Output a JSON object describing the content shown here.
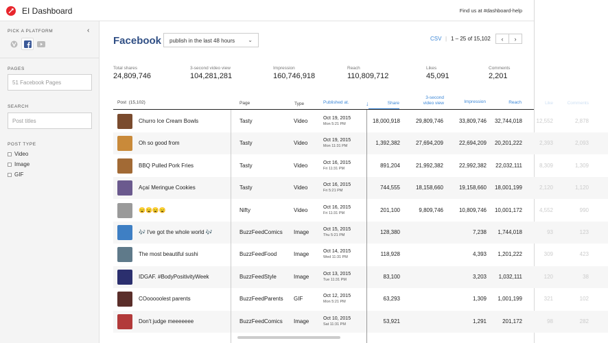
{
  "app": {
    "title": "EI Dashboard",
    "help_text": "Find us at #dashboard-help",
    "brand_color": "#e8262d"
  },
  "sidebar": {
    "platform_heading": "PICK A PLATFORM",
    "platforms": [
      {
        "name": "vine-icon",
        "active": false
      },
      {
        "name": "facebook-icon",
        "active": true
      },
      {
        "name": "youtube-icon",
        "active": false
      }
    ],
    "pages_heading": "PAGES",
    "pages_value": "51 Facebook Pages",
    "search_heading": "SEARCH",
    "search_placeholder": "Post titles",
    "post_type_heading": "POST TYPE",
    "post_types": [
      "Video",
      "Image",
      "GIF"
    ]
  },
  "main": {
    "title": "Facebook",
    "range_select": "publish in the last 48 hours",
    "csv": "CSV",
    "pagination": "1 – 25 of 15,102",
    "accent_color": "#3b86d6"
  },
  "totals": [
    {
      "label": "Total shares",
      "value": "24,809,746"
    },
    {
      "label": "3-second video view",
      "value": "104,281,281"
    },
    {
      "label": "Impression",
      "value": "160,746,918"
    },
    {
      "label": "Reach",
      "value": "110,809,712"
    },
    {
      "label": "Likes",
      "value": "45,091"
    },
    {
      "label": "Comments",
      "value": "2,201"
    }
  ],
  "columns": {
    "post": "Post",
    "post_count": "(15,102)",
    "page": "Page",
    "type": "Type",
    "published": "Published at.",
    "share": "Share",
    "video_view_1": "3-second",
    "video_view_2": "video view",
    "impression": "Impression",
    "reach": "Reach",
    "like": "Like",
    "comments": "Comments"
  },
  "rows": [
    {
      "post": "Churro Ice Cream Bowls",
      "page": "Tasty",
      "type": "Video",
      "date": "Oct 19, 2015",
      "time": "Mon  5:21 PM",
      "share": "18,000,918",
      "view": "29,809,746",
      "impression": "33,809,746",
      "reach": "32,744,018",
      "like": "12,552",
      "comments": "2,878",
      "thumb": "#7a4b2e"
    },
    {
      "post": "Oh so good from",
      "page": "Tasty",
      "type": "Video",
      "date": "Oct 19, 2015",
      "time": "Mon  11:31 PM",
      "share": "1,392,382",
      "view": "27,694,209",
      "impression": "22,694,209",
      "reach": "20,201,222",
      "like": "2,393",
      "comments": "2,093",
      "thumb": "#c98a3a"
    },
    {
      "post": "BBQ Pulled Pork Fries",
      "page": "Tasty",
      "type": "Video",
      "date": "Oct 16, 2015",
      "time": "Fri  11:31 PM",
      "share": "891,204",
      "view": "21,992,382",
      "impression": "22,992,382",
      "reach": "22,032,111",
      "like": "8,309",
      "comments": "1,309",
      "thumb": "#a26a35"
    },
    {
      "post": "Açaí Meringue Cookies",
      "page": "Tasty",
      "type": "Video",
      "date": "Oct 16, 2015",
      "time": "Fri  5:21 PM",
      "share": "744,555",
      "view": "18,158,660",
      "impression": "19,158,660",
      "reach": "18,001,199",
      "like": "2,120",
      "comments": "1,120",
      "thumb": "#6b5a8e"
    },
    {
      "post": "😦😦😦😦",
      "page": "Nifty",
      "type": "Video",
      "date": "Oct 16, 2015",
      "time": "Fri  11:31 PM",
      "share": "201,100",
      "view": "9,809,746",
      "impression": "10,809,746",
      "reach": "10,001,172",
      "like": "4,552",
      "comments": "990",
      "thumb": "#9a9a9a"
    },
    {
      "post": "🎶 I've got the whole world 🎶",
      "page": "BuzzFeedComics",
      "type": "Image",
      "date": "Oct 15, 2015",
      "time": "Thu  5:21 PM",
      "share": "128,380",
      "view": "",
      "impression": "7,238",
      "reach": "1,744,018",
      "like": "93",
      "comments": "123",
      "thumb": "#3e7fc4"
    },
    {
      "post": "The most beautiful sushi",
      "page": "BuzzFeedFood",
      "type": "Image",
      "date": "Oct 14, 2015",
      "time": "Wed  11:31 PM",
      "share": "118,928",
      "view": "",
      "impression": "4,393",
      "reach": "1,201,222",
      "like": "309",
      "comments": "423",
      "thumb": "#5f7a8a"
    },
    {
      "post": "IDGAF. #BodyPositivityWeek",
      "page": "BuzzFeedStyle",
      "type": "Image",
      "date": "Oct 13, 2015",
      "time": "Tue  11:31 PM",
      "share": "83,100",
      "view": "",
      "impression": "3,203",
      "reach": "1,032,111",
      "like": "120",
      "comments": "38",
      "thumb": "#2b2f6e"
    },
    {
      "post": "COooooolest parents",
      "page": "BuzzFeedParents",
      "type": "GIF",
      "date": "Oct 12, 2015",
      "time": "Mon  5:21 PM",
      "share": "63,293",
      "view": "",
      "impression": "1,309",
      "reach": "1,001,199",
      "like": "321",
      "comments": "102",
      "thumb": "#5a2e2a"
    },
    {
      "post": "Don't judge meeeeeee",
      "page": "BuzzFeedComics",
      "type": "Image",
      "date": "Oct 10, 2015",
      "time": "Sat  11:31 PM",
      "share": "53,921",
      "view": "",
      "impression": "1,291",
      "reach": "201,172",
      "like": "98",
      "comments": "282",
      "thumb": "#b23a3a"
    }
  ]
}
